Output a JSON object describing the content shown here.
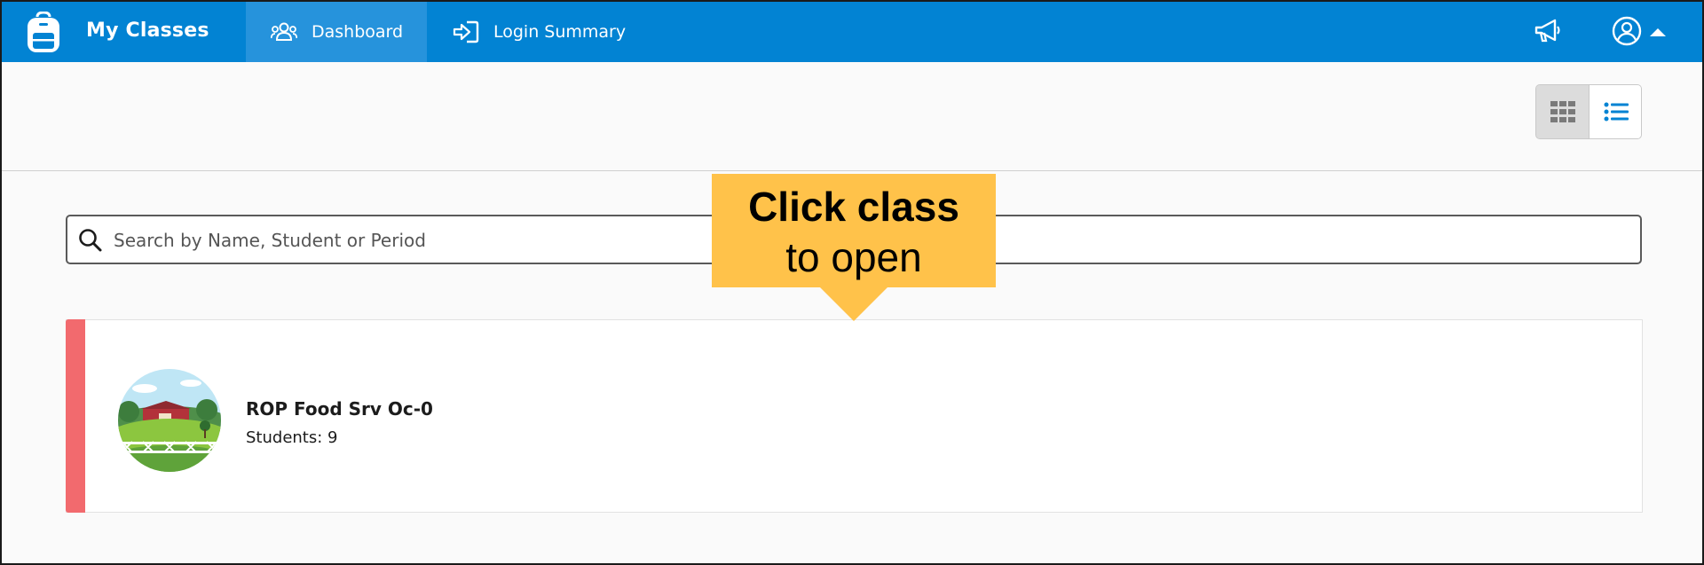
{
  "header": {
    "app_title": "My Classes",
    "tabs": [
      {
        "label": "Dashboard",
        "icon": "users-icon",
        "active": true
      },
      {
        "label": "Login Summary",
        "icon": "sign-in-icon",
        "active": false
      }
    ],
    "icons": [
      "backpack-icon",
      "megaphone-icon",
      "user-circle-icon",
      "caret-up-icon"
    ]
  },
  "view_toggle": {
    "options": [
      "grid-view-icon",
      "list-view-icon"
    ],
    "selected": "list"
  },
  "search": {
    "placeholder": "Search by Name, Student or Period"
  },
  "classes": [
    {
      "name": "ROP Food Srv Oc-0",
      "students": "Students: 9",
      "accent_color": "#f26a6e"
    }
  ],
  "callout": {
    "line1": "Click class",
    "line2": "to open"
  },
  "colors": {
    "topbar": "#0283d3",
    "active_tab": "#2693dc",
    "callout": "#ffc24a",
    "accent": "#f26a6e"
  }
}
